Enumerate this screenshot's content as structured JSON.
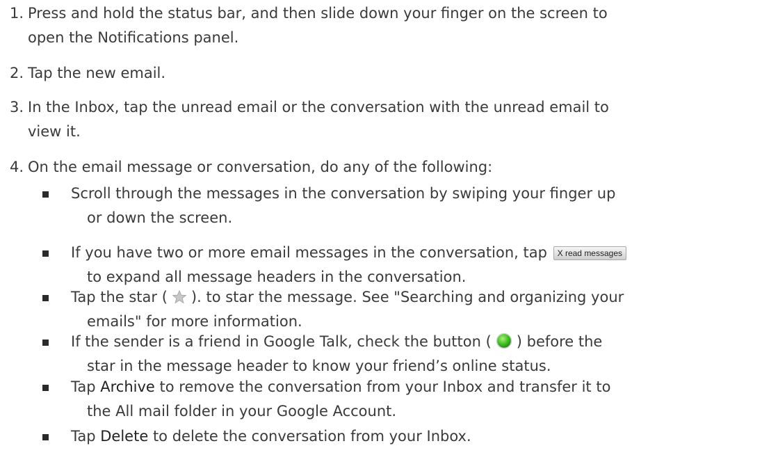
{
  "steps": [
    {
      "num": "1.",
      "text": "Press and hold the status bar, and then slide down your finger on the screen to",
      "cont": "open the Notifications panel."
    },
    {
      "num": "2.",
      "text": "Tap the new email."
    },
    {
      "num": "3.",
      "text": "In the Inbox, tap the unread email or the conversation with the unread email to",
      "cont": "view it."
    },
    {
      "num": "4.",
      "text": "On the email message or conversation, do any of the following:"
    }
  ],
  "bullets": {
    "b1": {
      "line1": "Scroll through the messages in the conversation by swiping your finger up",
      "line2": "or down the screen."
    },
    "b2": {
      "pre": "If you have two or more email messages in the conversation, tap",
      "button": "X read messages",
      "line2": "to expand all message headers in the conversation."
    },
    "b3": {
      "pre": "Tap the star (",
      "post": "). to star the message. See \"Searching and organizing your",
      "line2": "emails\" for more information."
    },
    "b4": {
      "pre": "If the sender is a friend in Google Talk, check the button (",
      "post": ") before the",
      "line2": "star in the message header to know your friend’s online status."
    },
    "b5": {
      "pre": "Tap",
      "bold": "Archive",
      "post": "to remove the conversation from your Inbox and transfer it to",
      "line2": "the All mail folder in your Google Account."
    },
    "b6": {
      "pre": "Tap",
      "bold": "Delete",
      "post": "to delete the conversation from your Inbox."
    }
  },
  "colors": {
    "text": "#3a3a3a",
    "presence": "#3fbf1f",
    "star": "#c8c8c8"
  }
}
